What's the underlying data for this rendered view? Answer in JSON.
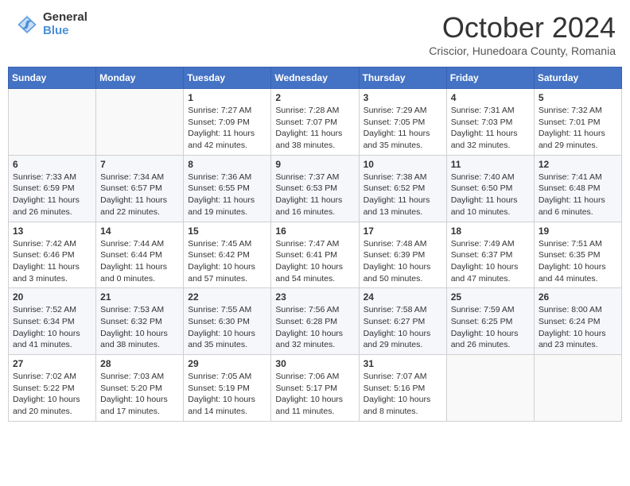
{
  "header": {
    "logo_general": "General",
    "logo_blue": "Blue",
    "month_title": "October 2024",
    "location": "Criscior, Hunedoara County, Romania"
  },
  "days_of_week": [
    "Sunday",
    "Monday",
    "Tuesday",
    "Wednesday",
    "Thursday",
    "Friday",
    "Saturday"
  ],
  "weeks": [
    [
      {
        "day": "",
        "content": ""
      },
      {
        "day": "",
        "content": ""
      },
      {
        "day": "1",
        "content": "Sunrise: 7:27 AM\nSunset: 7:09 PM\nDaylight: 11 hours and 42 minutes."
      },
      {
        "day": "2",
        "content": "Sunrise: 7:28 AM\nSunset: 7:07 PM\nDaylight: 11 hours and 38 minutes."
      },
      {
        "day": "3",
        "content": "Sunrise: 7:29 AM\nSunset: 7:05 PM\nDaylight: 11 hours and 35 minutes."
      },
      {
        "day": "4",
        "content": "Sunrise: 7:31 AM\nSunset: 7:03 PM\nDaylight: 11 hours and 32 minutes."
      },
      {
        "day": "5",
        "content": "Sunrise: 7:32 AM\nSunset: 7:01 PM\nDaylight: 11 hours and 29 minutes."
      }
    ],
    [
      {
        "day": "6",
        "content": "Sunrise: 7:33 AM\nSunset: 6:59 PM\nDaylight: 11 hours and 26 minutes."
      },
      {
        "day": "7",
        "content": "Sunrise: 7:34 AM\nSunset: 6:57 PM\nDaylight: 11 hours and 22 minutes."
      },
      {
        "day": "8",
        "content": "Sunrise: 7:36 AM\nSunset: 6:55 PM\nDaylight: 11 hours and 19 minutes."
      },
      {
        "day": "9",
        "content": "Sunrise: 7:37 AM\nSunset: 6:53 PM\nDaylight: 11 hours and 16 minutes."
      },
      {
        "day": "10",
        "content": "Sunrise: 7:38 AM\nSunset: 6:52 PM\nDaylight: 11 hours and 13 minutes."
      },
      {
        "day": "11",
        "content": "Sunrise: 7:40 AM\nSunset: 6:50 PM\nDaylight: 11 hours and 10 minutes."
      },
      {
        "day": "12",
        "content": "Sunrise: 7:41 AM\nSunset: 6:48 PM\nDaylight: 11 hours and 6 minutes."
      }
    ],
    [
      {
        "day": "13",
        "content": "Sunrise: 7:42 AM\nSunset: 6:46 PM\nDaylight: 11 hours and 3 minutes."
      },
      {
        "day": "14",
        "content": "Sunrise: 7:44 AM\nSunset: 6:44 PM\nDaylight: 11 hours and 0 minutes."
      },
      {
        "day": "15",
        "content": "Sunrise: 7:45 AM\nSunset: 6:42 PM\nDaylight: 10 hours and 57 minutes."
      },
      {
        "day": "16",
        "content": "Sunrise: 7:47 AM\nSunset: 6:41 PM\nDaylight: 10 hours and 54 minutes."
      },
      {
        "day": "17",
        "content": "Sunrise: 7:48 AM\nSunset: 6:39 PM\nDaylight: 10 hours and 50 minutes."
      },
      {
        "day": "18",
        "content": "Sunrise: 7:49 AM\nSunset: 6:37 PM\nDaylight: 10 hours and 47 minutes."
      },
      {
        "day": "19",
        "content": "Sunrise: 7:51 AM\nSunset: 6:35 PM\nDaylight: 10 hours and 44 minutes."
      }
    ],
    [
      {
        "day": "20",
        "content": "Sunrise: 7:52 AM\nSunset: 6:34 PM\nDaylight: 10 hours and 41 minutes."
      },
      {
        "day": "21",
        "content": "Sunrise: 7:53 AM\nSunset: 6:32 PM\nDaylight: 10 hours and 38 minutes."
      },
      {
        "day": "22",
        "content": "Sunrise: 7:55 AM\nSunset: 6:30 PM\nDaylight: 10 hours and 35 minutes."
      },
      {
        "day": "23",
        "content": "Sunrise: 7:56 AM\nSunset: 6:28 PM\nDaylight: 10 hours and 32 minutes."
      },
      {
        "day": "24",
        "content": "Sunrise: 7:58 AM\nSunset: 6:27 PM\nDaylight: 10 hours and 29 minutes."
      },
      {
        "day": "25",
        "content": "Sunrise: 7:59 AM\nSunset: 6:25 PM\nDaylight: 10 hours and 26 minutes."
      },
      {
        "day": "26",
        "content": "Sunrise: 8:00 AM\nSunset: 6:24 PM\nDaylight: 10 hours and 23 minutes."
      }
    ],
    [
      {
        "day": "27",
        "content": "Sunrise: 7:02 AM\nSunset: 5:22 PM\nDaylight: 10 hours and 20 minutes."
      },
      {
        "day": "28",
        "content": "Sunrise: 7:03 AM\nSunset: 5:20 PM\nDaylight: 10 hours and 17 minutes."
      },
      {
        "day": "29",
        "content": "Sunrise: 7:05 AM\nSunset: 5:19 PM\nDaylight: 10 hours and 14 minutes."
      },
      {
        "day": "30",
        "content": "Sunrise: 7:06 AM\nSunset: 5:17 PM\nDaylight: 10 hours and 11 minutes."
      },
      {
        "day": "31",
        "content": "Sunrise: 7:07 AM\nSunset: 5:16 PM\nDaylight: 10 hours and 8 minutes."
      },
      {
        "day": "",
        "content": ""
      },
      {
        "day": "",
        "content": ""
      }
    ]
  ]
}
